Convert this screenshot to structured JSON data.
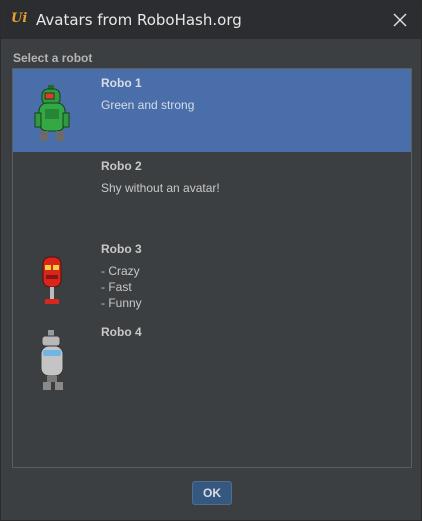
{
  "window": {
    "title": "Avatars from RoboHash.org",
    "app_icon_glyph": "Ui",
    "close_icon": "close-icon"
  },
  "section_label": "Select a robot",
  "robots": [
    {
      "name": "Robo 1",
      "lines": [
        "Green and strong"
      ],
      "avatar": "green-robot-icon",
      "selected": true
    },
    {
      "name": "Robo 2",
      "lines": [
        "Shy without an avatar!"
      ],
      "avatar": null,
      "selected": false
    },
    {
      "name": "Robo 3",
      "lines": [
        "- Crazy",
        "- Fast",
        "- Funny"
      ],
      "avatar": "red-robot-icon",
      "selected": false
    },
    {
      "name": "Robo 4",
      "lines": [],
      "avatar": "gray-robot-icon",
      "selected": false
    }
  ],
  "buttons": {
    "ok_label": "OK"
  },
  "colors": {
    "selection": "#4a6ea9",
    "background": "#3c3f41",
    "titlebar": "#2b2d30",
    "accent": "#e6a02b"
  }
}
